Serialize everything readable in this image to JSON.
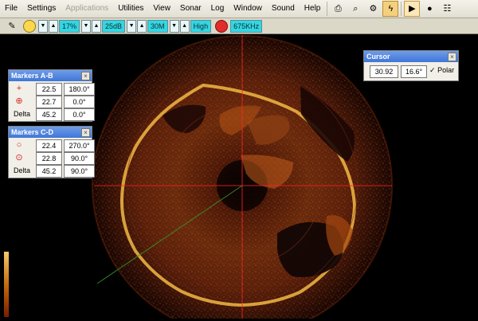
{
  "menu": {
    "items": [
      "File",
      "Settings",
      "Applications",
      "Utilities",
      "View",
      "Sonar",
      "Log",
      "Window",
      "Sound",
      "Help"
    ],
    "disabled": [
      false,
      false,
      true,
      false,
      false,
      false,
      false,
      false,
      false,
      false
    ]
  },
  "toolbar_icons": [
    "print-icon",
    "print-preview-icon",
    "page-setup-icon",
    "lightning-icon",
    "play-icon",
    "record-icon",
    "options-icon"
  ],
  "status": {
    "range_percent": "17%",
    "gain": "25dB",
    "distance": "30M",
    "quality": "High",
    "frequency": "675KHz",
    "record_color": "#e22b2b"
  },
  "markers_ab": {
    "title": "Markers A-B",
    "rows": [
      {
        "icon": "+",
        "value": "22.5",
        "angle": "180.0°"
      },
      {
        "icon": "⊕",
        "value": "22.7",
        "angle": "0.0°"
      },
      {
        "label": "Delta",
        "value": "45.2",
        "angle": "0.0°"
      }
    ]
  },
  "markers_cd": {
    "title": "Markers C-D",
    "rows": [
      {
        "icon": "○",
        "value": "22.4",
        "angle": "270.0°"
      },
      {
        "icon": "⊙",
        "value": "22.8",
        "angle": "90.0°"
      },
      {
        "label": "Delta",
        "value": "45.2",
        "angle": "90.0°"
      }
    ]
  },
  "cursor_panel": {
    "title": "Cursor",
    "distance": "30.92",
    "angle": "16.6°",
    "polar_label": "Polar",
    "polar_checked": true
  },
  "colors": {
    "sonar_warm": "#f3c552",
    "sonar_mid": "#a54812",
    "sonar_dark": "#220803",
    "crosshair": "#ff2222",
    "panel_title": "#4b84e0"
  }
}
